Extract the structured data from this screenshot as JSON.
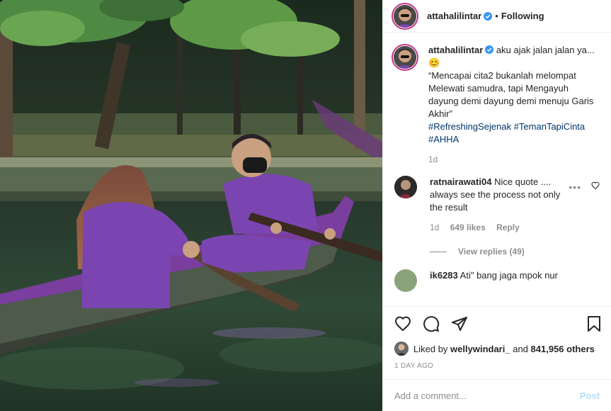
{
  "header": {
    "username": "attahalilintar",
    "separator": "•",
    "follow_label": "Following"
  },
  "caption": {
    "username": "attahalilintar",
    "text_line1": "aku ajak jalan jalan ya...",
    "emoji": "😊",
    "quote": "“Mencapai cita2 bukanlah melompat Melewati samudra, tapi Mengayuh dayung demi dayung demi menuju Garis Akhir”",
    "hashtags": [
      "#RefreshingSejenak",
      "#TemanTapiCinta",
      "#AHHA"
    ],
    "age": "1d"
  },
  "comments": [
    {
      "username": "ratnairawati04",
      "text": "Nice quote .... always see the process not only the result",
      "age": "1d",
      "likes": "649 likes",
      "reply_label": "Reply",
      "view_replies": "View replies (49)",
      "more": "•••"
    },
    {
      "username": "ik6283",
      "text": "Ati\" bang jaga mpok nur"
    }
  ],
  "actions": {
    "liked_by_prefix": "Liked by",
    "liked_by_user": "wellywindari_",
    "liked_by_and": "and",
    "liked_by_count": "841,956 others",
    "timestamp": "1 DAY AGO"
  },
  "comment_box": {
    "placeholder": "Add a comment...",
    "post_label": "Post"
  },
  "icons": {
    "like": "heart-icon",
    "comment": "comment-icon",
    "share": "share-icon",
    "save": "bookmark-icon",
    "verified": "verified-badge-icon"
  },
  "colors": {
    "link": "#00376b",
    "muted": "#8e8e8e",
    "post_disabled": "#b2dffc",
    "verified": "#3897f0",
    "story_ring": "#c13584"
  }
}
